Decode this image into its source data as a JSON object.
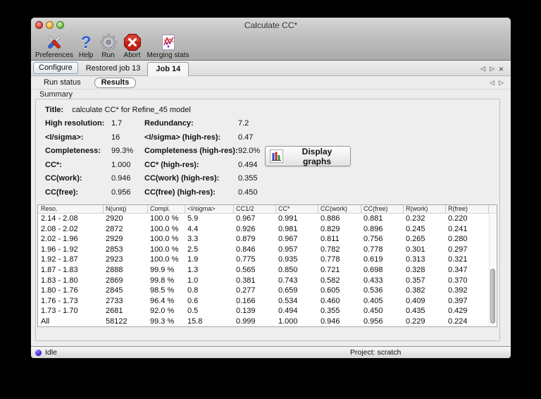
{
  "window": {
    "title": "Calculate CC*"
  },
  "toolbar": {
    "items": [
      {
        "label": "Preferences",
        "icon": "preferences-tools-icon"
      },
      {
        "label": "Help",
        "icon": "help-question-icon"
      },
      {
        "label": "Run",
        "icon": "run-gear-icon"
      },
      {
        "label": "Abort",
        "icon": "abort-stop-icon"
      },
      {
        "label": "Merging stats",
        "icon": "merging-stats-graph-icon"
      }
    ]
  },
  "tabs": {
    "main": [
      {
        "label": "Configure"
      },
      {
        "label": "Restored job 13"
      },
      {
        "label": "Job 14",
        "active": true
      }
    ],
    "sub": [
      {
        "label": "Run status"
      },
      {
        "label": "Results",
        "active": true
      }
    ],
    "nav_icons": [
      "left-arrow-icon",
      "right-arrow-icon",
      "close-icon"
    ]
  },
  "summary": {
    "section_label": "Summary",
    "title_label": "Title:",
    "title_value": "calculate CC* for Refine_45 model",
    "rows": [
      {
        "label1": "High resolution:",
        "value1": "1.7",
        "label2": "Redundancy:",
        "value2": "7.2"
      },
      {
        "label1": "<I/sigma>:",
        "value1": "16",
        "label2": "<I/sigma> (high-res):",
        "value2": "0.47"
      },
      {
        "label1": "Completeness:",
        "value1": "99.3%",
        "label2": "Completeness (high-res):",
        "value2": "92.0%"
      },
      {
        "label1": "CC*:",
        "value1": "1.000",
        "label2": "CC* (high-res):",
        "value2": "0.494"
      },
      {
        "label1": "CC(work):",
        "value1": "0.946",
        "label2": "CC(work) (high-res):",
        "value2": "0.355"
      },
      {
        "label1": "CC(free):",
        "value1": "0.956",
        "label2": "CC(free) (high-res):",
        "value2": "0.450"
      }
    ],
    "display_graphs_label": "Display graphs"
  },
  "table": {
    "columns": [
      "Reso.",
      "N(uniq)",
      "Compl.",
      "<I/sigma>",
      "CC1/2",
      "CC*",
      "CC(work)",
      "CC(free)",
      "R(work)",
      "R(free)"
    ],
    "rows": [
      [
        "2.14 - 2.08",
        "2920",
        "100.0 %",
        "5.9",
        "0.967",
        "0.991",
        "0.886",
        "0.881",
        "0.232",
        "0.220"
      ],
      [
        "2.08 - 2.02",
        "2872",
        "100.0 %",
        "4.4",
        "0.926",
        "0.981",
        "0.829",
        "0.896",
        "0.245",
        "0.241"
      ],
      [
        "2.02 - 1.96",
        "2929",
        "100.0 %",
        "3.3",
        "0.879",
        "0.967",
        "0.811",
        "0.756",
        "0.265",
        "0.280"
      ],
      [
        "1.96 - 1.92",
        "2853",
        "100.0 %",
        "2.5",
        "0.846",
        "0.957",
        "0.782",
        "0.778",
        "0.301",
        "0.297"
      ],
      [
        "1.92 - 1.87",
        "2923",
        "100.0 %",
        "1.9",
        "0.775",
        "0.935",
        "0.778",
        "0.619",
        "0.313",
        "0.321"
      ],
      [
        "1.87 - 1.83",
        "2888",
        "99.9 %",
        "1.3",
        "0.565",
        "0.850",
        "0.721",
        "0.698",
        "0.328",
        "0.347"
      ],
      [
        "1.83 - 1.80",
        "2869",
        "99.8 %",
        "1.0",
        "0.381",
        "0.743",
        "0.582",
        "0.433",
        "0.357",
        "0.370"
      ],
      [
        "1.80 - 1.76",
        "2845",
        "98.5 %",
        "0.8",
        "0.277",
        "0.659",
        "0.605",
        "0.536",
        "0.382",
        "0.392"
      ],
      [
        "1.76 - 1.73",
        "2733",
        "96.4 %",
        "0.6",
        "0.166",
        "0.534",
        "0.460",
        "0.405",
        "0.409",
        "0.397"
      ],
      [
        "1.73 - 1.70",
        "2681",
        "92.0 %",
        "0.5",
        "0.139",
        "0.494",
        "0.355",
        "0.450",
        "0.435",
        "0.429"
      ],
      [
        "All",
        "58122",
        "99.3 %",
        "15.8",
        "0.999",
        "1.000",
        "0.946",
        "0.956",
        "0.229",
        "0.224"
      ]
    ]
  },
  "status_bar": {
    "status": "Idle",
    "indicator_icon": "idle-indicator-icon",
    "project": "Project: scratch"
  },
  "colors": {
    "help_blue": "#2b62d9",
    "abort_red": "#c52015",
    "idle_indicator_blue": "#3c2ce0",
    "graph_bar_blue": "#2f4fd0",
    "graph_bar_red": "#cc2a1e",
    "graph_bar_green": "#1f9e35",
    "active_tab_bg": "#f6f6f6",
    "window_bg": "#ededed"
  }
}
